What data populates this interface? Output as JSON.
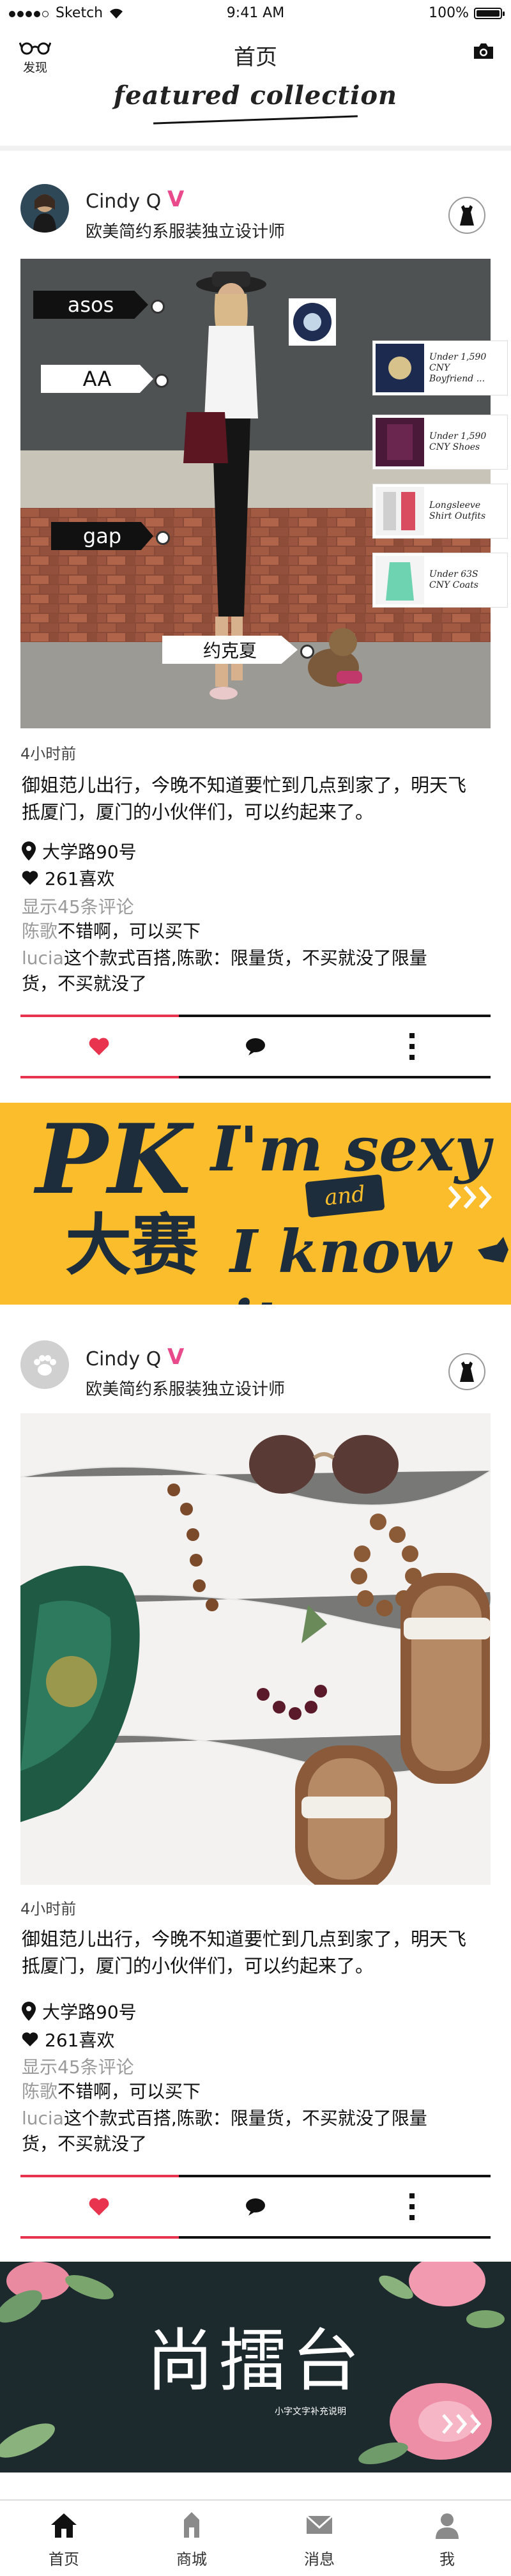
{
  "status_bar": {
    "carrier": "Sketch",
    "time": "9:41 AM",
    "battery": "100%"
  },
  "nav": {
    "discover_label": "发现",
    "title": "首页",
    "featured": "featured collection"
  },
  "posts": [
    {
      "user_name": "Cindy Q",
      "verified_mark": "V",
      "user_title": "欧美简约系服装独立设计师",
      "time_ago": "4小时前",
      "body_line1": "御姐范儿出行，今晚不知道要忙到几点到家了，明天飞",
      "body_line2": "抵厦门，厦门的小伙伴们，可以约起来了。",
      "location": "大学路90号",
      "likes": "261喜欢",
      "show_comments": "显示45条评论",
      "comment1_user": "陈歌",
      "comment1_text": "不错啊，可以买下",
      "comment2_user": "lucia",
      "comment2_text_line1": "这个款式百搭,陈歌：限量货，不买就没了限量",
      "comment2_text_line2": "货，不买就没了",
      "tags": [
        "asos",
        "AA",
        "gap",
        "约克夏"
      ],
      "products": [
        {
          "line1": "Under 1,590",
          "line2": "CNY",
          "line3": "Boyfriend ..."
        },
        {
          "line1": "Under 1,590",
          "line2": "CNY Shoes",
          "line3": ""
        },
        {
          "line1": "Longsleeve",
          "line2": "Shirt Outfits",
          "line3": ""
        },
        {
          "line1": "Under 63S",
          "line2": "CNY Coats",
          "line3": ""
        }
      ]
    },
    {
      "user_name": "Cindy Q",
      "verified_mark": "V",
      "user_title": "欧美简约系服装独立设计师",
      "time_ago": "4小时前",
      "body_line1": "御姐范儿出行，今晚不知道要忙到几点到家了，明天飞",
      "body_line2": "抵厦门，厦门的小伙伴们，可以约起来了。",
      "location": "大学路90号",
      "likes": "261喜欢",
      "show_comments": "显示45条评论",
      "comment1_user": "陈歌",
      "comment1_text": "不错啊，可以买下",
      "comment2_user": "lucia",
      "comment2_text_line1": "这个款式百搭,陈歌：限量货，不买就没了限量",
      "comment2_text_line2": "货，不买就没了"
    }
  ],
  "banner_pk": {
    "pk": "PK",
    "contest": "大赛",
    "line1": "I'm sexy",
    "and": "and",
    "line2": "I know it"
  },
  "banner_stage": {
    "title": "尚擂台",
    "subtitle": "小字文字补充说明"
  },
  "tabs": [
    {
      "label": "首页",
      "icon": "home-icon"
    },
    {
      "label": "商城",
      "icon": "mall-icon"
    },
    {
      "label": "消息",
      "icon": "message-icon"
    },
    {
      "label": "我",
      "icon": "profile-icon"
    }
  ],
  "colors": {
    "accent_pink": "#e8344e",
    "banner_yellow": "#fbbd2b",
    "banner_dark": "#1c2a2e",
    "verified": "#e84a8c"
  }
}
